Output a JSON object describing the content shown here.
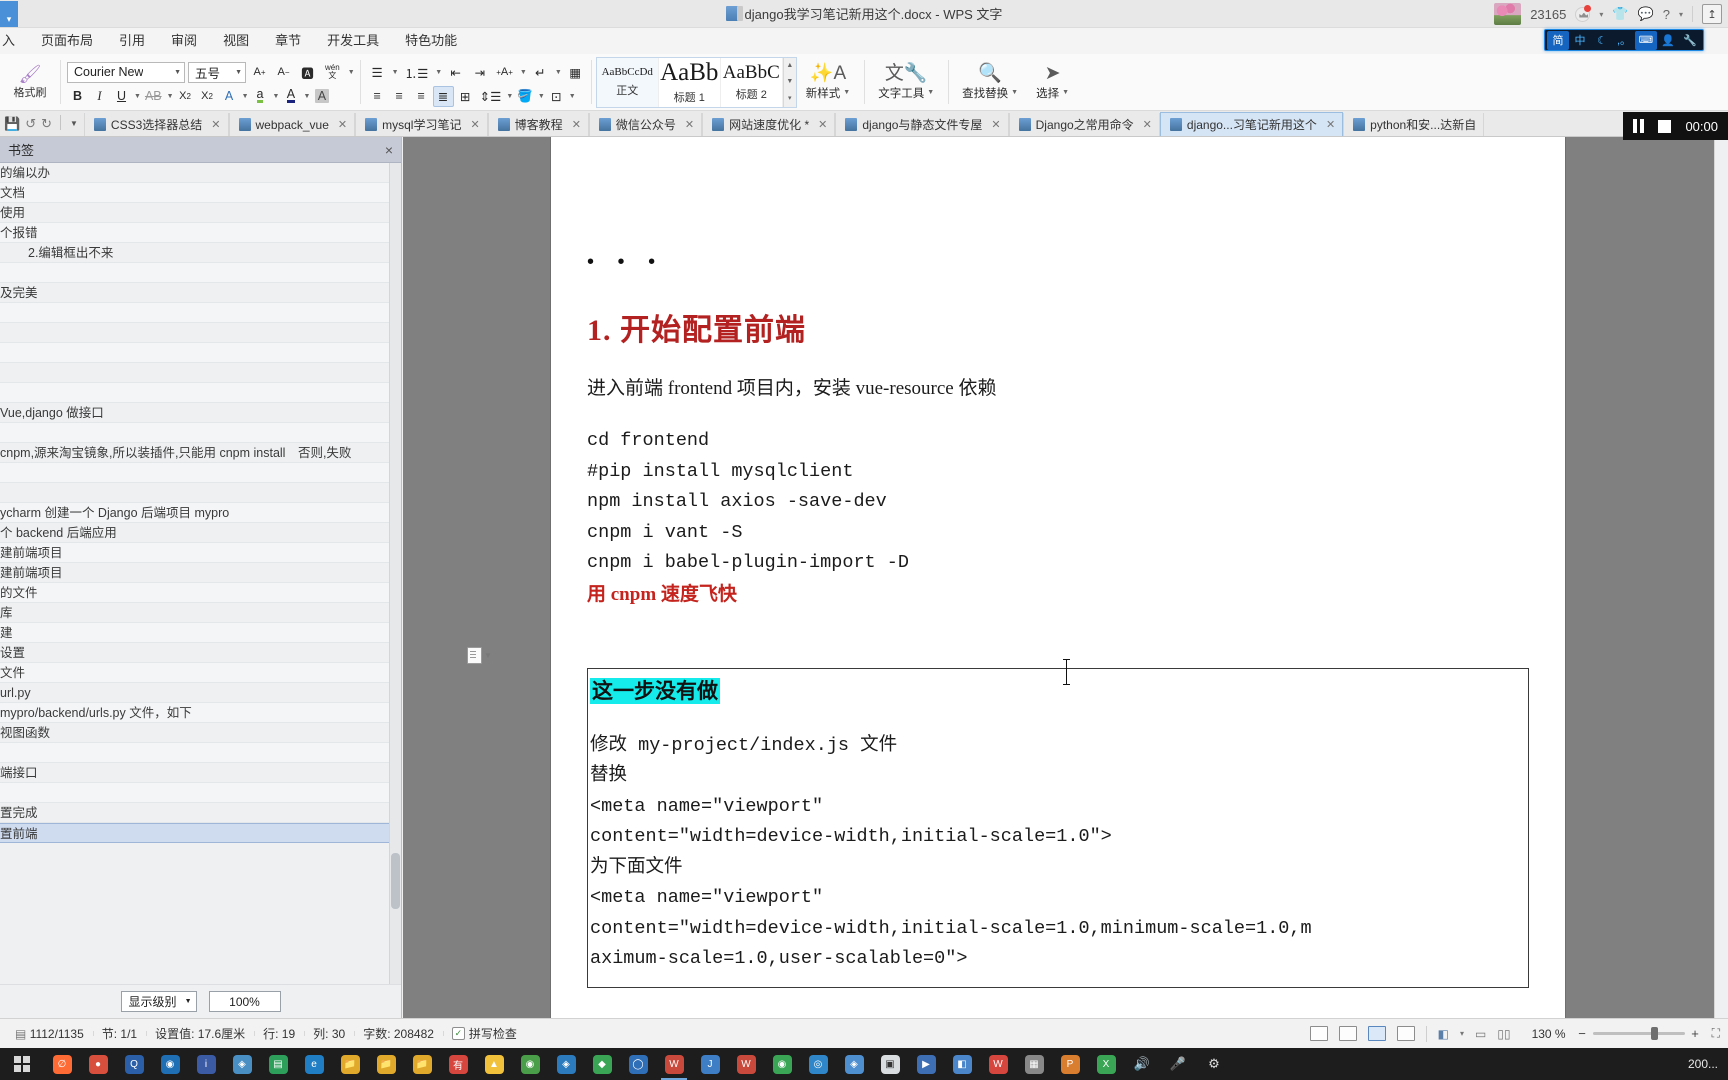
{
  "titlebar": {
    "document_title": "django我学习笔记新用这个.docx - WPS 文字",
    "account_number": "23165",
    "icons": [
      "crown-icon",
      "shirt-icon",
      "chat-icon",
      "help-icon",
      "share-icon"
    ]
  },
  "menubar": {
    "items": [
      "入",
      "页面布局",
      "引用",
      "审阅",
      "视图",
      "章节",
      "开发工具",
      "特色功能"
    ]
  },
  "ime": {
    "items": [
      "简",
      "中",
      "moon",
      "punct",
      "keyboard",
      "user",
      "wrench"
    ]
  },
  "ribbon": {
    "format_painter": "格式刷",
    "font_name": "Courier New",
    "font_size": "五号",
    "grow_font": "A",
    "shrink_font": "A",
    "clear_format": "A",
    "pinyin": "wén",
    "bold": "B",
    "italic": "I",
    "underline": "U",
    "strike": "AB",
    "superscript": "X",
    "subscript": "X",
    "text_effect": "A",
    "highlight": "ab",
    "font_color": "A",
    "char_shading": "A",
    "styles": [
      {
        "preview": "AaBbCcDd",
        "label": "正文",
        "selected": true
      },
      {
        "preview": "AaBb",
        "label": "标题 1",
        "selected": false
      },
      {
        "preview": "AaBbC",
        "label": "标题 2",
        "selected": false
      }
    ],
    "new_style": "新样式",
    "text_tools": "文字工具",
    "find_replace": "查找替换",
    "select": "选择"
  },
  "tabstrip": {
    "quick_access": [
      "save-icon",
      "undo-icon",
      "redo-icon",
      "dropdown-icon"
    ],
    "tabs": [
      {
        "label": "CSS3选择器总结",
        "active": false
      },
      {
        "label": "webpack_vue",
        "active": false
      },
      {
        "label": "mysql学习笔记",
        "active": false
      },
      {
        "label": "博客教程",
        "active": false
      },
      {
        "label": "微信公众号",
        "active": false
      },
      {
        "label": "网站速度优化 *",
        "active": false
      },
      {
        "label": "django与静态文件专屋",
        "active": false
      },
      {
        "label": "Django之常用命令",
        "active": false
      },
      {
        "label": "django...习笔记新用这个",
        "active": true
      },
      {
        "label": "python和安...达新自",
        "active": false
      }
    ]
  },
  "media_controls": {
    "pause": "pause-icon",
    "stop": "stop-icon",
    "time": "00:00"
  },
  "bookmarks_panel": {
    "title": "书签",
    "close": "×",
    "items": [
      {
        "label": "的编以办",
        "indent": false,
        "selected": false
      },
      {
        "label": "文档",
        "indent": false,
        "selected": false
      },
      {
        "label": "使用",
        "indent": false,
        "selected": false
      },
      {
        "label": "个报错",
        "indent": false,
        "selected": false
      },
      {
        "label": "2.编辑框出不来",
        "indent": true,
        "selected": false
      },
      {
        "label": "",
        "indent": false,
        "selected": false
      },
      {
        "label": "及完美",
        "indent": false,
        "selected": false
      },
      {
        "label": "",
        "indent": false,
        "selected": false
      },
      {
        "label": "",
        "indent": false,
        "selected": false
      },
      {
        "label": "",
        "indent": false,
        "selected": false
      },
      {
        "label": "",
        "indent": false,
        "selected": false
      },
      {
        "label": "",
        "indent": false,
        "selected": false
      },
      {
        "label": "Vue,django 做接口",
        "indent": false,
        "selected": false
      },
      {
        "label": "",
        "indent": false,
        "selected": false
      },
      {
        "label": "cnpm,源来淘宝镜象,所以装插件,只能用 cnpm install　否则,失败",
        "indent": false,
        "selected": false
      },
      {
        "label": "",
        "indent": false,
        "selected": false
      },
      {
        "label": "",
        "indent": false,
        "selected": false
      },
      {
        "label": "ycharm 创建一个 Django 后端项目 mypro",
        "indent": false,
        "selected": false
      },
      {
        "label": "个 backend 后端应用",
        "indent": false,
        "selected": false
      },
      {
        "label": "建前端项目",
        "indent": false,
        "selected": false
      },
      {
        "label": "建前端项目",
        "indent": false,
        "selected": false
      },
      {
        "label": "的文件",
        "indent": false,
        "selected": false
      },
      {
        "label": "库",
        "indent": false,
        "selected": false
      },
      {
        "label": "建",
        "indent": false,
        "selected": false
      },
      {
        "label": "设置",
        "indent": false,
        "selected": false
      },
      {
        "label": "文件",
        "indent": false,
        "selected": false
      },
      {
        "label": "url.py",
        "indent": false,
        "selected": false
      },
      {
        "label": "mypro/backend/urls.py 文件，如下",
        "indent": false,
        "selected": false
      },
      {
        "label": "视图函数",
        "indent": false,
        "selected": false
      },
      {
        "label": "",
        "indent": false,
        "selected": false
      },
      {
        "label": "端接口",
        "indent": false,
        "selected": false
      },
      {
        "label": "",
        "indent": false,
        "selected": false
      },
      {
        "label": "置完成",
        "indent": false,
        "selected": false
      },
      {
        "label": "置前端",
        "indent": false,
        "selected": true
      }
    ],
    "display_level_label": "显示级别",
    "zoom_label": "100%"
  },
  "document": {
    "ellipsis": "• • •",
    "heading": "1. 开始配置前端",
    "intro": "进入前端 frontend 项目内，安装 vue-resource 依赖",
    "code_lines": [
      "cd frontend",
      "#pip install mysqlclient",
      "npm install axios -save-dev",
      "cnpm i vant -S",
      "cnpm i babel-plugin-import -D"
    ],
    "red_note": "用 cnpm 速度飞快",
    "box": {
      "highlight_title": "这一步没有做",
      "lines": [
        "修改 my-project/index.js 文件",
        "替换",
        "<meta name=\"viewport\"",
        "content=\"width=device-width,initial-scale=1.0\">",
        "为下面文件",
        "<meta name=\"viewport\"",
        "content=\"width=device-width,initial-scale=1.0,minimum-scale=1.0,m",
        "aximum-scale=1.0,user-scalable=0\">"
      ]
    }
  },
  "statusbar": {
    "page_count": "1112/1135",
    "section": "节: 1/1",
    "position": "设置值: 17.6厘米",
    "line": "行: 19",
    "column": "列: 30",
    "word_count": "字数: 208482",
    "spellcheck": "拼写检查",
    "zoom_percent": "130 %",
    "zoom_minus": "−",
    "zoom_plus": "+"
  },
  "taskbar": {
    "clock": "200...",
    "wps_label": "W"
  }
}
